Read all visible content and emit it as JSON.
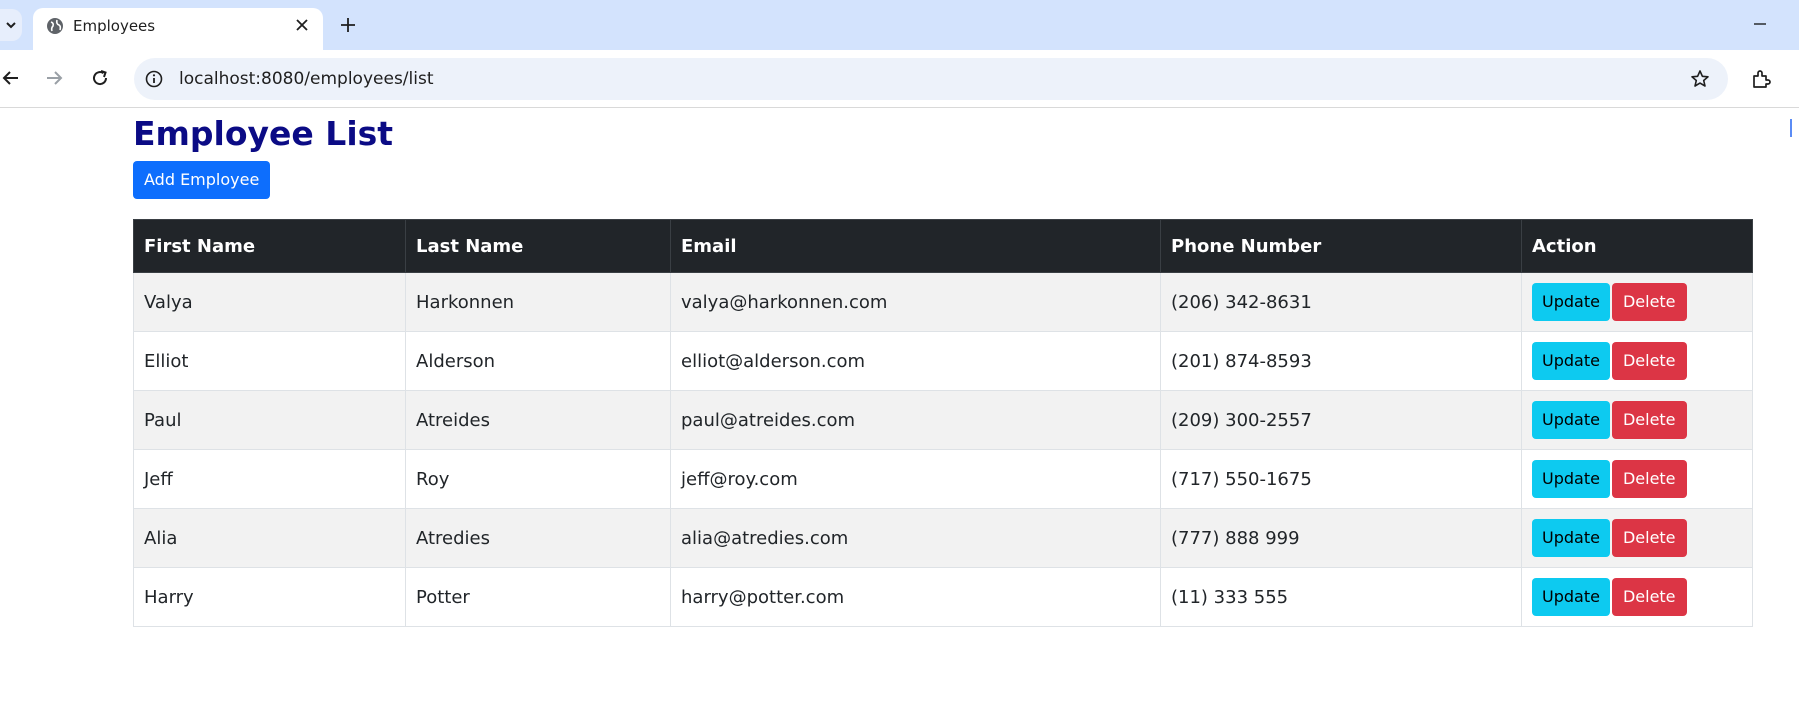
{
  "browser": {
    "tab_title": "Employees",
    "url": "localhost:8080/employees/list"
  },
  "page": {
    "title": "Employee List",
    "add_button": "Add Employee",
    "columns": [
      "First Name",
      "Last Name",
      "Email",
      "Phone Number",
      "Action"
    ],
    "rows": [
      {
        "first": "Valya",
        "last": "Harkonnen",
        "email": "valya@harkonnen.com",
        "phone": "(206) 342-8631"
      },
      {
        "first": "Elliot",
        "last": "Alderson",
        "email": "elliot@alderson.com",
        "phone": "(201) 874-8593"
      },
      {
        "first": "Paul",
        "last": "Atreides",
        "email": "paul@atreides.com",
        "phone": "(209) 300-2557"
      },
      {
        "first": "Jeff",
        "last": "Roy",
        "email": "jeff@roy.com",
        "phone": "(717) 550-1675"
      },
      {
        "first": "Alia",
        "last": "Atredies",
        "email": "alia@atredies.com",
        "phone": "(777) 888 999"
      },
      {
        "first": "Harry",
        "last": "Potter",
        "email": "harry@potter.com",
        "phone": "(11) 333 555"
      }
    ],
    "update_label": "Update",
    "delete_label": "Delete"
  },
  "colors": {
    "title": "#0b0b85",
    "primary": "#0d6efd",
    "info": "#0dcaf0",
    "danger": "#dc3545",
    "table_header": "#212529"
  }
}
